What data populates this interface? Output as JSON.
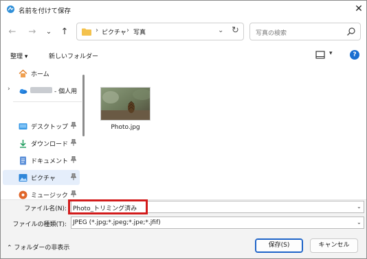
{
  "window": {
    "title": "名前を付けて保存",
    "close_label": "✕"
  },
  "nav": {
    "back_label": "←",
    "forward_label": "→",
    "recent_label": "⌄",
    "up_label": "↑"
  },
  "address": {
    "breadcrumbs": [
      "ピクチャ",
      "写真"
    ],
    "sep": "›",
    "dropdown_label": "⌄",
    "refresh_label": "↻"
  },
  "search": {
    "placeholder": "写真の検索"
  },
  "toolbar": {
    "organize_label": "整理 ▾",
    "new_folder_label": "新しいフォルダー",
    "view_dropdown_label": "▾",
    "help_label": "?"
  },
  "navpane": {
    "items": [
      {
        "label": "ホーム",
        "icon": "home-icon"
      },
      {
        "label": "- 個人用",
        "icon": "onedrive-icon",
        "expand": "›"
      },
      {
        "label": "デスクトップ",
        "icon": "desktop-icon",
        "pinned": true
      },
      {
        "label": "ダウンロード",
        "icon": "download-icon",
        "pinned": true
      },
      {
        "label": "ドキュメント",
        "icon": "document-icon",
        "pinned": true
      },
      {
        "label": "ピクチャ",
        "icon": "pictures-icon",
        "pinned": true,
        "selected": true
      },
      {
        "label": "ミュージック",
        "icon": "music-icon",
        "pinned": true
      }
    ]
  },
  "files": [
    {
      "name": "Photo.jpg",
      "icon": "image-thumbnail"
    }
  ],
  "bottom": {
    "filename_label": "ファイル名(N):",
    "filename_value": "Photo_トリミング済み",
    "filetype_label": "ファイルの種類(T):",
    "filetype_value": "JPEG (*.jpg;*.jpeg;*.jpe;*.jfif)",
    "dropdown_caret": "⌄",
    "hide_folders_label": "⌃  フォルダーの非表示",
    "save_label": "保存(S)",
    "cancel_label": "キャンセル"
  },
  "colors": {
    "accent": "#1a6fd1",
    "highlight_red": "#d21b1b",
    "folder_yellow": "#f4c24d",
    "selected_bg": "#e5eefb"
  }
}
